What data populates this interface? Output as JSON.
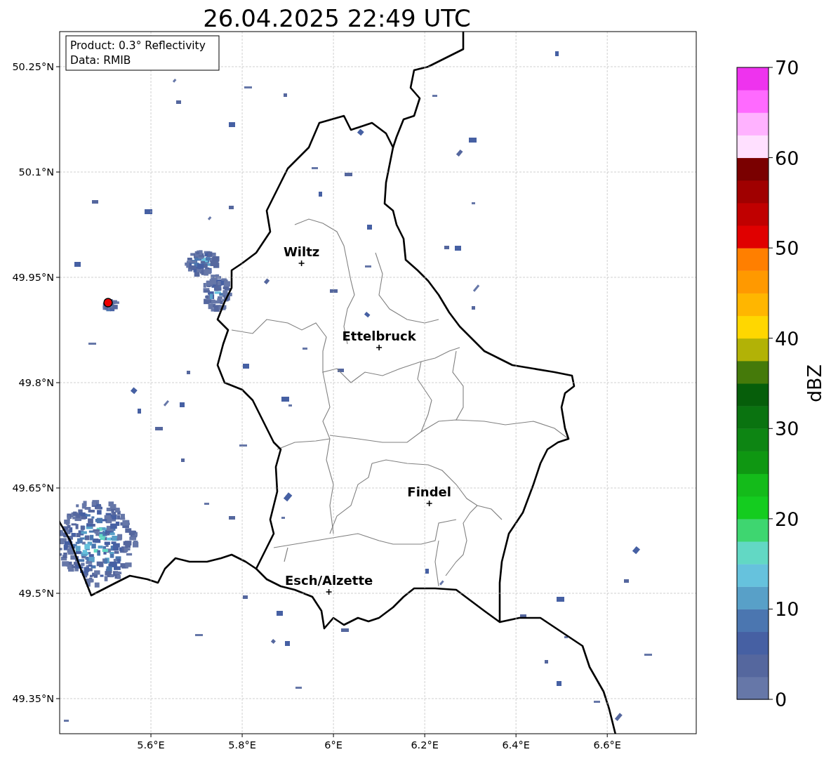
{
  "title": "26.04.2025 22:49 UTC",
  "info_box": [
    "Product: 0.3° Reflectivity",
    "Data: RMIB"
  ],
  "map": {
    "chart_data": {
      "type": "scatter",
      "xlim": [
        5.4,
        6.795
      ],
      "ylim": [
        49.3,
        50.3
      ],
      "xticks": [
        {
          "value": 5.6,
          "label": "5.6°E"
        },
        {
          "value": 5.8,
          "label": "5.8°E"
        },
        {
          "value": 6.0,
          "label": "6°E"
        },
        {
          "value": 6.2,
          "label": "6.2°E"
        },
        {
          "value": 6.4,
          "label": "6.4°E"
        },
        {
          "value": 6.6,
          "label": "6.6°E"
        }
      ],
      "yticks": [
        {
          "value": 49.35,
          "label": "49.35°N"
        },
        {
          "value": 49.5,
          "label": "49.5°N"
        },
        {
          "value": 49.65,
          "label": "49.65°N"
        },
        {
          "value": 49.8,
          "label": "49.8°N"
        },
        {
          "value": 49.95,
          "label": "49.95°N"
        },
        {
          "value": 50.1,
          "label": "50.1°N"
        },
        {
          "value": 50.25,
          "label": "50.25°N"
        }
      ],
      "x": [
        5.93,
        6.1,
        6.21,
        5.99
      ],
      "grid": true,
      "series": [
        {
          "color": "#000000",
          "values": [
            49.97,
            49.85,
            49.628,
            49.502
          ]
        }
      ],
      "annotations": [
        {
          "text": "Wiltz",
          "x": 5.93,
          "y": 49.97
        },
        {
          "text": "Ettelbruck",
          "x": 6.1,
          "y": 49.85
        },
        {
          "text": "Findel",
          "x": 6.21,
          "y": 49.628
        },
        {
          "text": "Esch/Alzette",
          "x": 5.99,
          "y": 49.502
        }
      ]
    }
  },
  "colorbar": {
    "label": "dBZ",
    "ticks": [
      "70",
      "60",
      "50",
      "40",
      "30",
      "20",
      "10",
      "0"
    ],
    "bands": [
      {
        "color": "#6677a8"
      },
      {
        "color": "#55679e"
      },
      {
        "color": "#4660a3"
      },
      {
        "color": "#4b76b0"
      },
      {
        "color": "#58a0c8"
      },
      {
        "color": "#66c2dd"
      },
      {
        "color": "#62d8c4"
      },
      {
        "color": "#3ed670"
      },
      {
        "color": "#14cc1f"
      },
      {
        "color": "#14bb1a"
      },
      {
        "color": "#0f9712"
      },
      {
        "color": "#0d8513"
      },
      {
        "color": "#0a7310"
      },
      {
        "color": "#065e0a"
      },
      {
        "color": "#457a0a"
      },
      {
        "color": "#b2b206"
      },
      {
        "color": "#ffd700"
      },
      {
        "color": "#ffb600"
      },
      {
        "color": "#ff9900"
      },
      {
        "color": "#ff7f00"
      },
      {
        "color": "#e00000"
      },
      {
        "color": "#c00000"
      },
      {
        "color": "#a00000"
      },
      {
        "color": "#7a0000"
      },
      {
        "color": "#ffe0ff"
      },
      {
        "color": "#ffb2ff"
      },
      {
        "color": "#ff6aff"
      },
      {
        "color": "#ee33ee"
      }
    ]
  }
}
